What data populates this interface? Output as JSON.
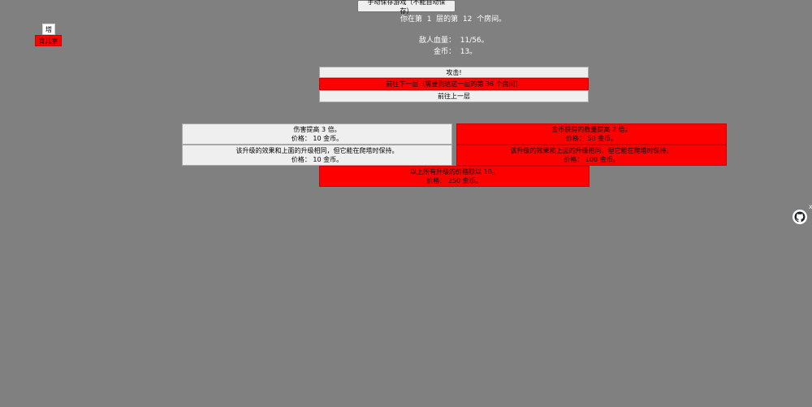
{
  "header": {
    "save_button": "手动保存游戏（不能自动保存）"
  },
  "tabs": [
    {
      "label": "塔"
    },
    {
      "label": "育儿室"
    }
  ],
  "status": {
    "room_text": "你在第  1  层的第  12  个房间。",
    "enemy_hp_text": "敌人血量：  11/56。",
    "coins_text": "金币：  13。"
  },
  "actions": {
    "attack": "攻击!",
    "next_floor": "前往下一层（需要到达这一层的第  36  个房间）",
    "prev_floor": "前往上一层"
  },
  "upgrades": [
    {
      "desc": "伤害提高  3  倍。",
      "price": "价格：  10  金币。",
      "affordable": true
    },
    {
      "desc": "金币获得的数量提高  2  倍。",
      "price": "价格：  50  金币。",
      "affordable": false
    },
    {
      "desc": "该升级的效果和上面的升级相同，但它能在爬塔时保持。",
      "price": "价格：  10  金币。",
      "affordable": true
    },
    {
      "desc": "该升级的效果和上面的升级相同，但它能在爬塔时保持。",
      "price": "价格：  100  金币。",
      "affordable": false
    },
    {
      "desc": "以上所有升级的价格除以  10。",
      "price": "价格：  250  金币。",
      "affordable": false
    }
  ],
  "corner": {
    "close_glyph": "x",
    "icon": "github-icon"
  },
  "colors": {
    "background": "#808080",
    "affordable": "#efefef",
    "unaffordable": "#ff0000"
  }
}
